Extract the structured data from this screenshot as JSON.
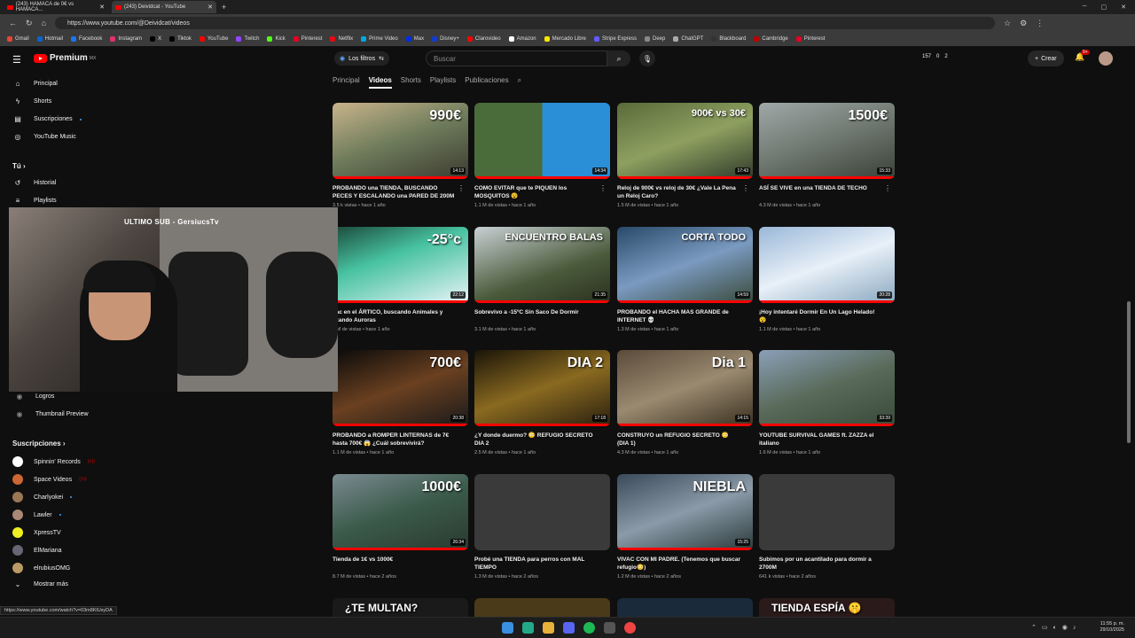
{
  "browser": {
    "tabs": [
      {
        "title": "(243) HAMACA de 0€ vs HAMACA..."
      },
      {
        "title": "(243) Deividcat - YouTube"
      }
    ],
    "url": "https://www.youtube.com/@Deividcat/videos",
    "bookmarks": [
      "Gmail",
      "Hotmail",
      "Facebook",
      "Instagram",
      "X",
      "Tiktok",
      "YouTube",
      "Twitch",
      "Kick",
      "Pinterest",
      "Netflix",
      "Prime Video",
      "Max",
      "Disney+",
      "Clarovideo",
      "Amazon",
      "Mercado Libre",
      "Stripe Express",
      "Deep",
      "ChatGPT",
      "Blackboard",
      "Cambridge",
      "Pinterest"
    ],
    "status_url": "https://www.youtube.com/watch?v=03m8KlUsyDA"
  },
  "header": {
    "logo": "Premium",
    "region": "MX",
    "filters_label": "Los filtros",
    "search_placeholder": "Buscar",
    "stats": [
      "157",
      "0",
      "2"
    ],
    "create_label": "Crear",
    "notif_count": "9+"
  },
  "channel_tabs": [
    "Principal",
    "Videos",
    "Shorts",
    "Playlists",
    "Publicaciones"
  ],
  "sidebar": {
    "top": [
      "Principal",
      "Shorts",
      "Suscripciones",
      "YouTube Music"
    ],
    "you_header": "Tú",
    "you_items": [
      "Historial",
      "Playlists"
    ],
    "extra_items": [
      "Logros",
      "Thumbnail Preview"
    ],
    "subs_header": "Suscripciones",
    "subs": [
      "Spinnin' Records",
      "Space Videos",
      "Charlyokei",
      "Lawler",
      "XpressTV",
      "ElMariana",
      "elrubiusOMG"
    ],
    "more": "Mostrar más"
  },
  "webcam_label": "ULTIMO SUB - GersiucsTv",
  "videos": [
    {
      "title": "PROBANDO una TIENDA, BUSCANDO PECES Y ESCALANDO una PARED DE 200M",
      "meta": "3.5 k vistas • hace 1 año",
      "dur": "14:13",
      "cap": "990€"
    },
    {
      "title": "COMO EVITAR que te PIQUEN los MOSQUITOS 😵",
      "meta": "1.1 M de vistas • hace 1 año",
      "dur": "14:34",
      "cap": ""
    },
    {
      "title": "Reloj de 900€ vs reloj de 30€ ¿Vale La Pena un Reloj Caro?",
      "meta": "1.5 M de vistas • hace 1 año",
      "dur": "17:43",
      "cap": "900€ vs 30€"
    },
    {
      "title": "ASÍ SE VIVE en una TIENDA DE TECHO",
      "meta": "4.3 M de vistas • hace 1 año",
      "dur": "15:33",
      "cap": "1500€"
    },
    {
      "title": "vac en el ÁRTICO, buscando Animales y azando Auroras",
      "meta": "2 M de vistas • hace 1 año",
      "dur": "22:12",
      "cap": "-25°c"
    },
    {
      "title": "Sobrevivo a -15ºC Sin Saco De Dormir",
      "meta": "3.1 M de vistas • hace 1 año",
      "dur": "21:35",
      "cap": "ENCUENTRO BALAS"
    },
    {
      "title": "PROBANDO el HACHA MAS GRANDE de INTERNET 💀",
      "meta": "1.3 M de vistas • hace 1 año",
      "dur": "14:59",
      "cap": "CORTA TODO"
    },
    {
      "title": "¡Hoy intentaré Dormir En Un Lago Helado! 😵",
      "meta": "1.1 M de vistas • hace 1 año",
      "dur": "20:28",
      "cap": ""
    },
    {
      "title": "PROBANDO a ROMPER LINTERNAS de 7€ hasta 700€ 😱 ¿Cuál sobrevivirá?",
      "meta": "1.1 M de vistas • hace 1 año",
      "dur": "20:38",
      "cap": "700€"
    },
    {
      "title": "¿Y donde duermo? 😳 REFUGIO SECRETO DIA 2",
      "meta": "2.5 M de vistas • hace 1 año",
      "dur": "17:18",
      "cap": "DIA 2"
    },
    {
      "title": "CONSTRUYO un REFUGIO SECRETO 😳 (DIA 1)",
      "meta": "4.3 M de vistas • hace 1 año",
      "dur": "14:15",
      "cap": "Dia 1"
    },
    {
      "title": "YOUTUBE SURVIVAL GAMES ft. ZAZZA el italiano",
      "meta": "1.6 M de vistas • hace 1 año",
      "dur": "33:39",
      "cap": ""
    },
    {
      "title": "Tienda de 1€ vs 1000€",
      "meta": "8.7 M de vistas • hace 2 años",
      "dur": "26:34",
      "cap": "1000€"
    },
    {
      "title": "Probé una TIENDA para perros con MAL TIEMPO",
      "meta": "1.3 M de vistas • hace 2 años",
      "dur": "",
      "cap": ""
    },
    {
      "title": "VIVAC CON MI PADRE. (Tenemos que buscar refugio😳)",
      "meta": "1.2 M de vistas • hace 2 años",
      "dur": "15:25",
      "cap": "NIEBLA"
    },
    {
      "title": "Subimos por un acantilado para dormir a 2700M",
      "meta": "641 k vistas • hace 2 años",
      "dur": "",
      "cap": ""
    }
  ],
  "next_row_caps": [
    "¿TE MULTAN?",
    "",
    "",
    "TIENDA ESPÍA 🤫"
  ],
  "taskbar": {
    "time": "11:55 p. m.",
    "date": "29/10/2025"
  }
}
